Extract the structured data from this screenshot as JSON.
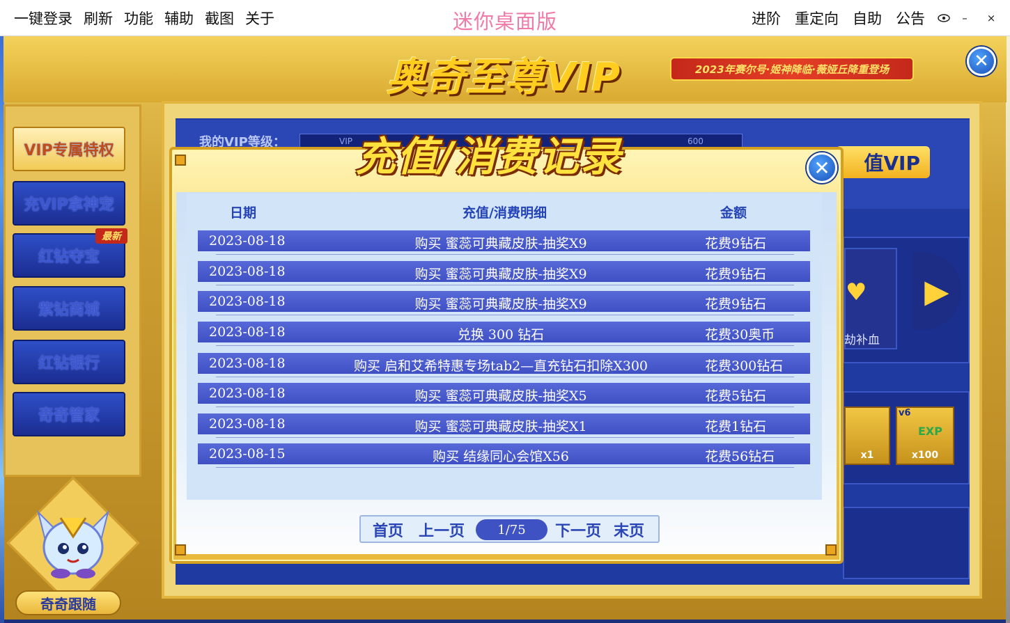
{
  "menubar": {
    "left_items": [
      "一键登录",
      "刷新",
      "功能",
      "辅助",
      "截图",
      "关于"
    ],
    "title": "迷你桌面版",
    "right_items": [
      "进阶",
      "重定向",
      "自助",
      "公告"
    ],
    "eye_icon": "eye-icon",
    "minimize_label": "–",
    "close_label": "×"
  },
  "vip_panel": {
    "title": "奥奇至尊VIP",
    "subtitle": "2023年赛尔号·姬神降临·薇娅丘降重登场",
    "level_label": "我的VIP等级：",
    "progress_left": "VIP",
    "progress_right": "600",
    "recharge_label": "值VIP",
    "card_label": "劫补血",
    "rewards": [
      {
        "label": "x1"
      },
      {
        "label": "x100",
        "tag": "v6"
      }
    ]
  },
  "sidenav": {
    "items": [
      "VIP专属特权",
      "充VIP拿神宠",
      "红钻夺宝",
      "紫钻商城",
      "红钻银行",
      "奇奇管家"
    ],
    "new_badge": "最新",
    "mascot_label": "奇奇跟随"
  },
  "dialog": {
    "title": "充值/消费记录",
    "columns": {
      "date": "日期",
      "detail": "充值/消费明细",
      "amount": "金额"
    },
    "rows": [
      {
        "date": "2023-08-18",
        "detail": "购买  蜜蕊可典藏皮肤-抽奖X9",
        "amount": "花费9钻石"
      },
      {
        "date": "2023-08-18",
        "detail": "购买  蜜蕊可典藏皮肤-抽奖X9",
        "amount": "花费9钻石"
      },
      {
        "date": "2023-08-18",
        "detail": "购买  蜜蕊可典藏皮肤-抽奖X9",
        "amount": "花费9钻石"
      },
      {
        "date": "2023-08-18",
        "detail": "兑换  300  钻石",
        "amount": "花费30奥币"
      },
      {
        "date": "2023-08-18",
        "detail": "购买  启和艾希特惠专场tab2—直充钻石扣除X300",
        "amount": "花费300钻石"
      },
      {
        "date": "2023-08-18",
        "detail": "购买  蜜蕊可典藏皮肤-抽奖X5",
        "amount": "花费5钻石"
      },
      {
        "date": "2023-08-18",
        "detail": "购买  蜜蕊可典藏皮肤-抽奖X1",
        "amount": "花费1钻石"
      },
      {
        "date": "2023-08-15",
        "detail": "购买  结缘同心会馆X56",
        "amount": "花费56钻石"
      }
    ],
    "pager": {
      "first": "首页",
      "prev": "上一页",
      "current": "1/75",
      "next": "下一页",
      "last": "末页"
    }
  },
  "colors": {
    "accent_pink": "#f07aa8",
    "gold": "#f2c744",
    "row_blue": "#4a5bcf",
    "header_blue": "#2544b6"
  }
}
